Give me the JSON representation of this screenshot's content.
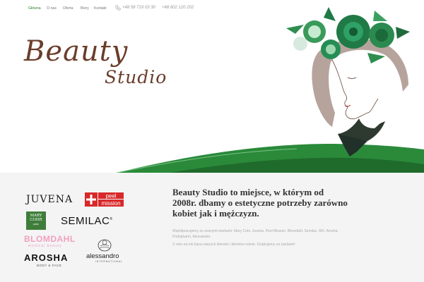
{
  "nav": {
    "items": [
      {
        "label": "Główna",
        "active": true
      },
      {
        "label": "O nas",
        "active": false
      },
      {
        "label": "Oferta",
        "active": false
      },
      {
        "label": "Biory",
        "active": false
      },
      {
        "label": "Kontakt",
        "active": false
      }
    ],
    "phone_icon": "phone-icon",
    "phone1": "+48 58 719 03 30",
    "phone2": "+48 602 120 202"
  },
  "hero": {
    "logo_line1": "Beauty",
    "logo_line2": "Studio"
  },
  "brands": {
    "juvena": "JUVENA",
    "peel_top": "peel",
    "peel_bottom": "mission",
    "marycohr": [
      "MARY",
      "COHR"
    ],
    "marycohr_sub": "paris",
    "semilac": "SEMILAC",
    "semilac_mark": "®",
    "blomdahl": "BLOMDAHL",
    "blomdahl_sub": "medical beauty",
    "arosha": "AROSHA",
    "arosha_sub": "BODY & FACE",
    "alessandro": "alessandro",
    "alessandro_sub": "INTERNATIONAL"
  },
  "about": {
    "heading": "Beauty Studio to miejsce, w którym od 2008r. dbamy o estetyczne potrzeby zarówno kobiet jak i mężczyzn.",
    "paragraph1": "Współpracujemy ze znanymi markami: Mary Cohr, Juvena, Peel Mission, Blomdahl, Semilac, IBX, Arosha, Podopharm, Alessandro.",
    "paragraph2": "Z roku na rok baza naszych klientek i klientów rośnie. Dziękujemy za zaufanie!"
  },
  "colors": {
    "accent_green": "#2f7d33",
    "logo_brown": "#6a3d2a",
    "section_bg": "#f4f4f4"
  }
}
